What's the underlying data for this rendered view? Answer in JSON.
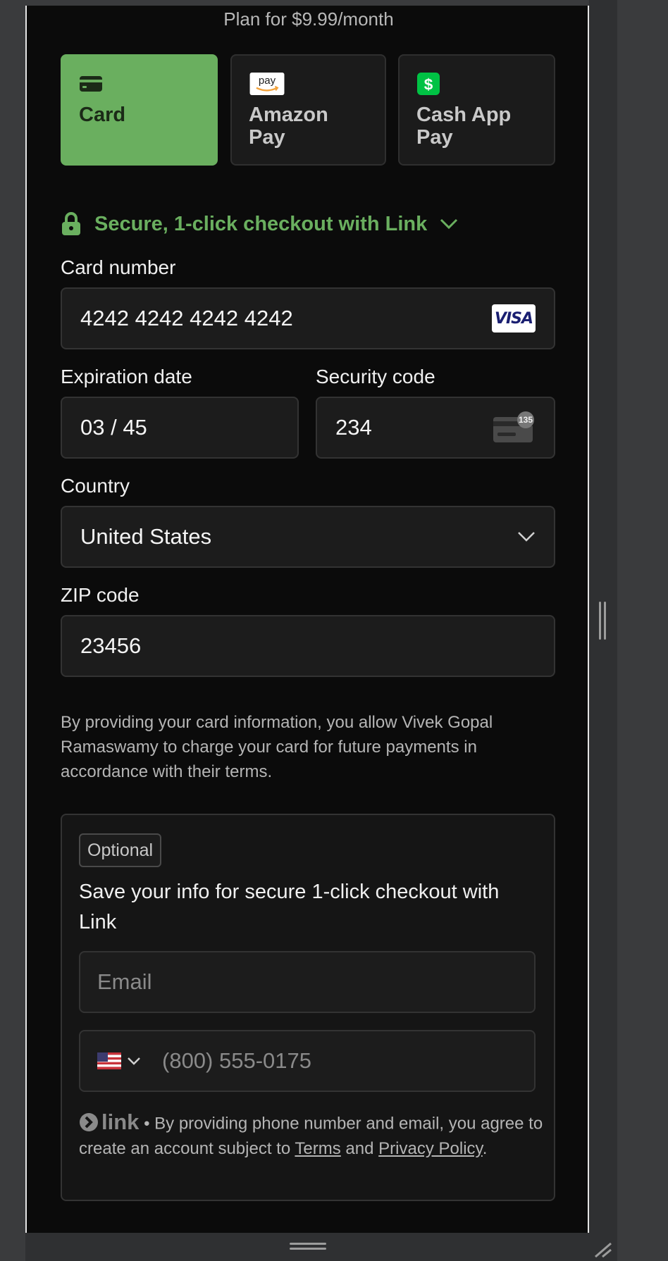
{
  "header": {
    "plan_text": "Plan for $9.99/month"
  },
  "payment_methods": [
    {
      "label": "Card",
      "icon": "card-icon",
      "active": true
    },
    {
      "label": "Amazon Pay",
      "icon": "amazon-pay-icon",
      "icon_text": "pay",
      "active": false
    },
    {
      "label": "Cash App Pay",
      "icon": "cash-app-icon",
      "icon_text": "$",
      "active": false
    }
  ],
  "link_checkout": {
    "label": "Secure, 1-click checkout with Link"
  },
  "card": {
    "number_label": "Card number",
    "number_value": "4242 4242 4242 4242",
    "brand": "VISA",
    "expiry_label": "Expiration date",
    "expiry_value": "03 / 45",
    "cvc_label": "Security code",
    "cvc_value": "234",
    "cvc_hint": "135",
    "country_label": "Country",
    "country_value": "United States",
    "zip_label": "ZIP code",
    "zip_value": "23456"
  },
  "consent_text": "By providing your card information, you allow Vivek Gopal Ramaswamy to charge your card for future payments in accordance with their terms.",
  "link_save": {
    "badge": "Optional",
    "title": "Save your info for secure 1-click checkout with Link",
    "email_placeholder": "Email",
    "phone_placeholder": "(800) 555-0175",
    "logo_text": "link",
    "footer_before": " • By providing phone number and email, you agree to create an account subject to ",
    "terms": "Terms",
    "and": " and ",
    "privacy": "Privacy Policy",
    "end": "."
  },
  "colors": {
    "accent": "#6aaf5f",
    "background": "#0b0b0b",
    "field": "#1c1c1c"
  }
}
